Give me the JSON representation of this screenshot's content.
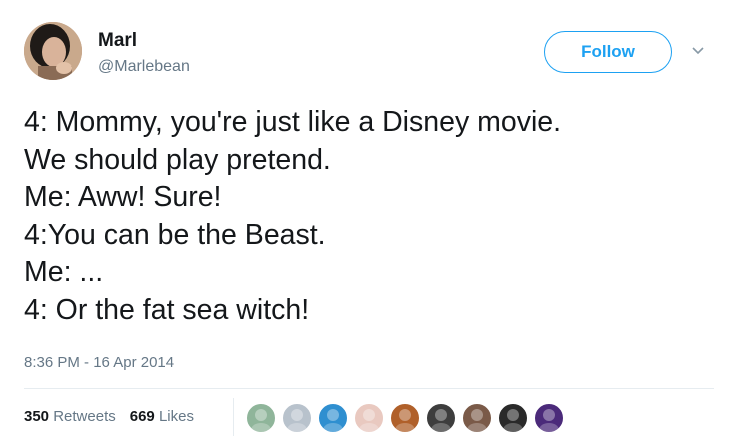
{
  "author": {
    "name": "Marl",
    "handle": "@Marlebean"
  },
  "follow": {
    "label": "Follow",
    "color": "#1da1f2"
  },
  "tweet": {
    "lines": [
      "4: Mommy, you're just like a Disney movie.",
      "We should play pretend.",
      "Me: Aww! Sure!",
      "4:You can be the Beast.",
      "Me: ...",
      "4: Or the fat sea witch!"
    ],
    "timestamp": "8:36 PM - 16 Apr 2014"
  },
  "stats": {
    "retweets_count": "350",
    "retweets_label": "Retweets",
    "likes_count": "669",
    "likes_label": "Likes"
  },
  "likers": [
    {
      "icon": "liker-avatar-1",
      "color": "#8fb59a"
    },
    {
      "icon": "liker-avatar-2",
      "color": "#b8c2cc"
    },
    {
      "icon": "liker-avatar-3",
      "color": "#2f8fd0"
    },
    {
      "icon": "liker-avatar-4",
      "color": "#e9c9c0"
    },
    {
      "icon": "liker-avatar-5",
      "color": "#b0602a"
    },
    {
      "icon": "liker-avatar-6",
      "color": "#3d3d3d"
    },
    {
      "icon": "liker-avatar-7",
      "color": "#7a5a48"
    },
    {
      "icon": "liker-avatar-8",
      "color": "#2a2a2a"
    },
    {
      "icon": "liker-avatar-9",
      "color": "#4b2a7a"
    }
  ]
}
